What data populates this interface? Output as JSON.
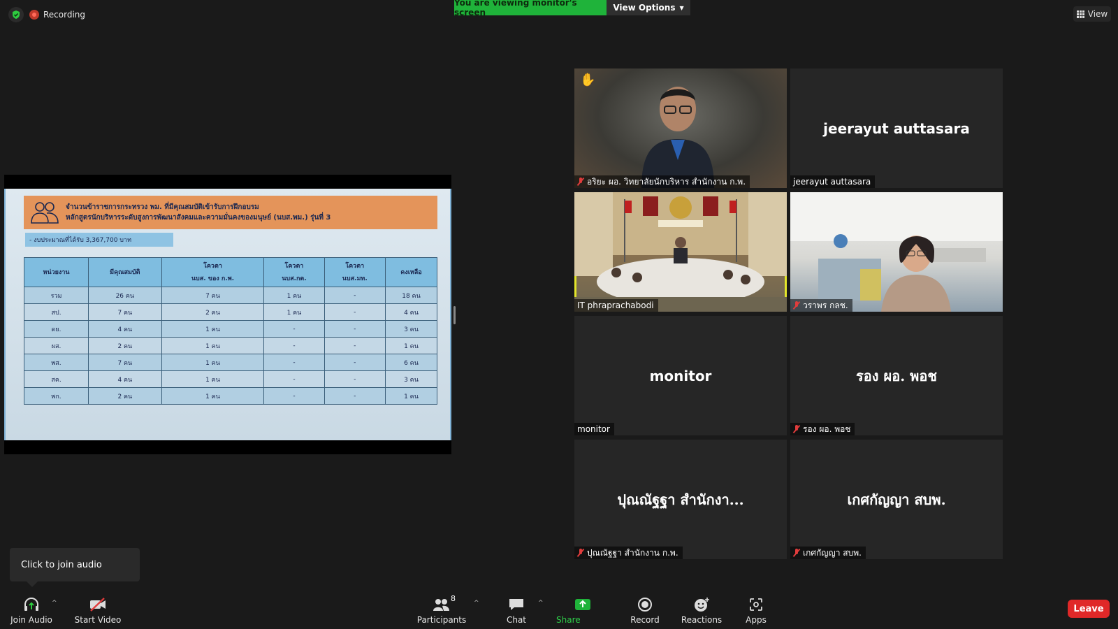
{
  "topbar": {
    "recording_label": "Recording",
    "viewing_banner": "You are viewing monitor's screen",
    "view_options_label": "View Options",
    "view_label": "View"
  },
  "slide": {
    "title_line1": "จำนวนข้าราชการกระทรวง พม. ที่มีคุณสมบัติเข้ารับการฝึกอบรม",
    "title_line2": "หลักสูตรนักบริหารระดับสูงการพัฒนาสังคมและความมั่นคงของมนุษย์ (นบส.พม.) รุ่นที่ 3",
    "budget": "- งบประมาณที่ได้รับ  3,367,700 บาท",
    "headers": [
      [
        "หน่วยงาน"
      ],
      [
        "มีคุณสมบัติ"
      ],
      [
        "โควตา",
        "นบส. ของ ก.พ."
      ],
      [
        "โควตา",
        "นบส.กต."
      ],
      [
        "โควตา",
        "นบส.มท."
      ],
      [
        "คงเหลือ"
      ]
    ],
    "rows": [
      [
        "รวม",
        "26 คน",
        "7 คน",
        "1 คน",
        "-",
        "18 คน"
      ],
      [
        "สป.",
        "7 คน",
        "2 คน",
        "1 คน",
        "-",
        "4 คน"
      ],
      [
        "ดย.",
        "4 คน",
        "1 คน",
        "-",
        "-",
        "3 คน"
      ],
      [
        "ผส.",
        "2 คน",
        "1 คน",
        "-",
        "-",
        "1 คน"
      ],
      [
        "พส.",
        "7 คน",
        "1 คน",
        "-",
        "-",
        "6 คน"
      ],
      [
        "สค.",
        "4 คน",
        "1 คน",
        "-",
        "-",
        "3 คน"
      ],
      [
        "พก.",
        "2 คน",
        "1 คน",
        "-",
        "-",
        "1 คน"
      ]
    ]
  },
  "participants": [
    {
      "name": "อริยะ ผอ. วิทยาลัยนักบริหาร สำนักงาน ก.พ.",
      "muted": true,
      "video": true,
      "raised_hand": true
    },
    {
      "name": "jeerayut auttasara",
      "display": "jeerayut auttasara",
      "muted": false,
      "video": false
    },
    {
      "name": "IT phraprachabodi",
      "muted": false,
      "video": true,
      "active_speaker": true
    },
    {
      "name": "วราพร กลช.",
      "muted": true,
      "video": true
    },
    {
      "name": "monitor",
      "display": "monitor",
      "muted": false,
      "video": false
    },
    {
      "name": "รอง ผอ. พอช",
      "display": "รอง ผอ. พอช",
      "muted": true,
      "video": false
    },
    {
      "name": "ปุณณัฐฐา สำนักงาน ก.พ.",
      "display": "ปุณณัฐฐา สำนักงา...",
      "muted": true,
      "video": false
    },
    {
      "name": "เกศกัญญา สบพ.",
      "display": "เกศกัญญา สบพ.",
      "muted": true,
      "video": false
    }
  ],
  "tooltip": "Click to join audio",
  "toolbar": {
    "join_audio": "Join Audio",
    "start_video": "Start Video",
    "participants": "Participants",
    "participants_count": "8",
    "chat": "Chat",
    "share_screen": "Share Screen",
    "record": "Record",
    "reactions": "Reactions",
    "apps": "Apps",
    "leave": "Leave"
  },
  "colors": {
    "share_green": "#1fb33a",
    "leave_red": "#e02828",
    "active_speaker": "#e3e62a",
    "slide_header": "#e4945a"
  }
}
